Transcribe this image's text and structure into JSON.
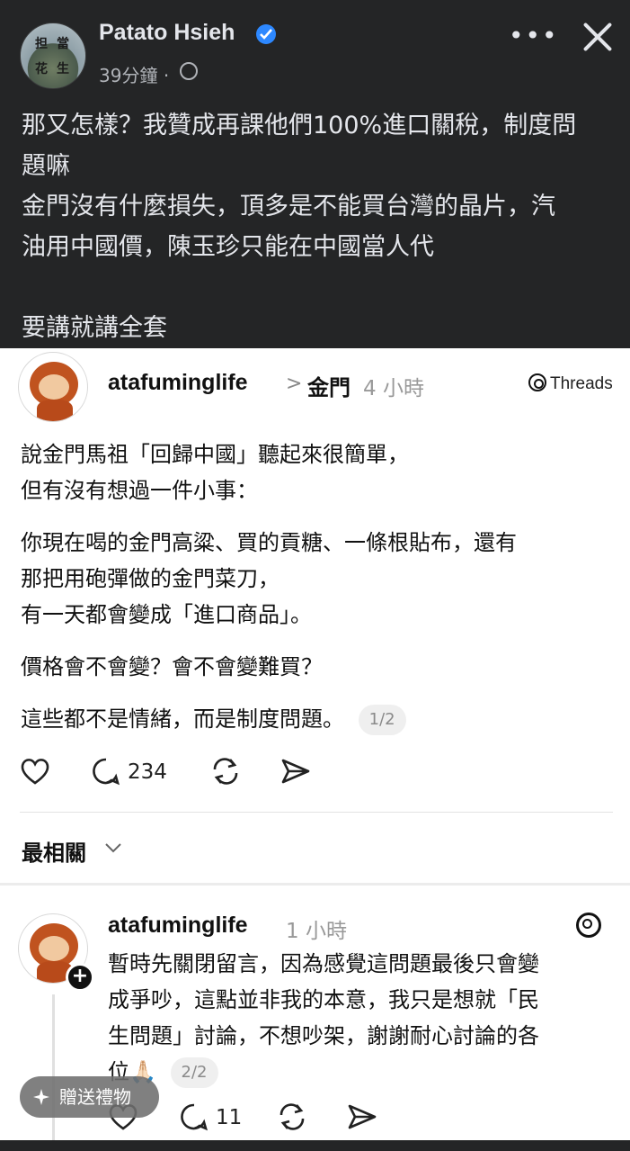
{
  "post": {
    "author": "Patato Hsieh",
    "avatar_text": [
      "担",
      "當",
      "花",
      "生"
    ],
    "time": "39分鐘",
    "time_separator": "·",
    "lines": [
      "那又怎樣？我贊成再課他們100%進口關稅，制度問",
      "題嘛",
      "金門沒有什麼損失，頂多是不能買台灣的晶片，汽",
      "油用中國價，陳玉珍只能在中國當人代",
      "",
      "要講就講全套"
    ]
  },
  "threads": {
    "brand": "Threads",
    "main_post": {
      "username": "atafuminglife",
      "separator": ">",
      "topic": "金門",
      "time": "4 小時",
      "paragraphs": [
        [
          "說金門馬祖「回歸中國」聽起來很簡單，",
          "但有沒有想過一件小事："
        ],
        [
          "你現在喝的金門高粱、買的貢糖、一條根貼布，還有",
          "那把用砲彈做的金門菜刀，",
          "有一天都會變成「進口商品」。"
        ],
        [
          "價格會不會變？會不會變難買？"
        ],
        [
          "這些都不是情緒，而是制度問題。"
        ]
      ],
      "pager": "1/2",
      "reply_count": "234"
    },
    "sort_label": "最相關",
    "reply": {
      "username": "atafuminglife",
      "time": "1 小時",
      "lines": [
        "暫時先關閉留言，因為感覺這問題最後只會變",
        "成爭吵，這點並非我的本意，我只是想就「民",
        "生問題」討論，不想吵架，謝謝耐心討論的各",
        "位🙏🏻"
      ],
      "pager": "2/2",
      "reply_count": "11"
    }
  },
  "gift_button": {
    "label": "贈送禮物"
  },
  "colors": {
    "fb_bg": "#242526",
    "fb_text": "#e4e6eb",
    "verified": "#2d88ff",
    "threads_bg": "#ffffff"
  }
}
